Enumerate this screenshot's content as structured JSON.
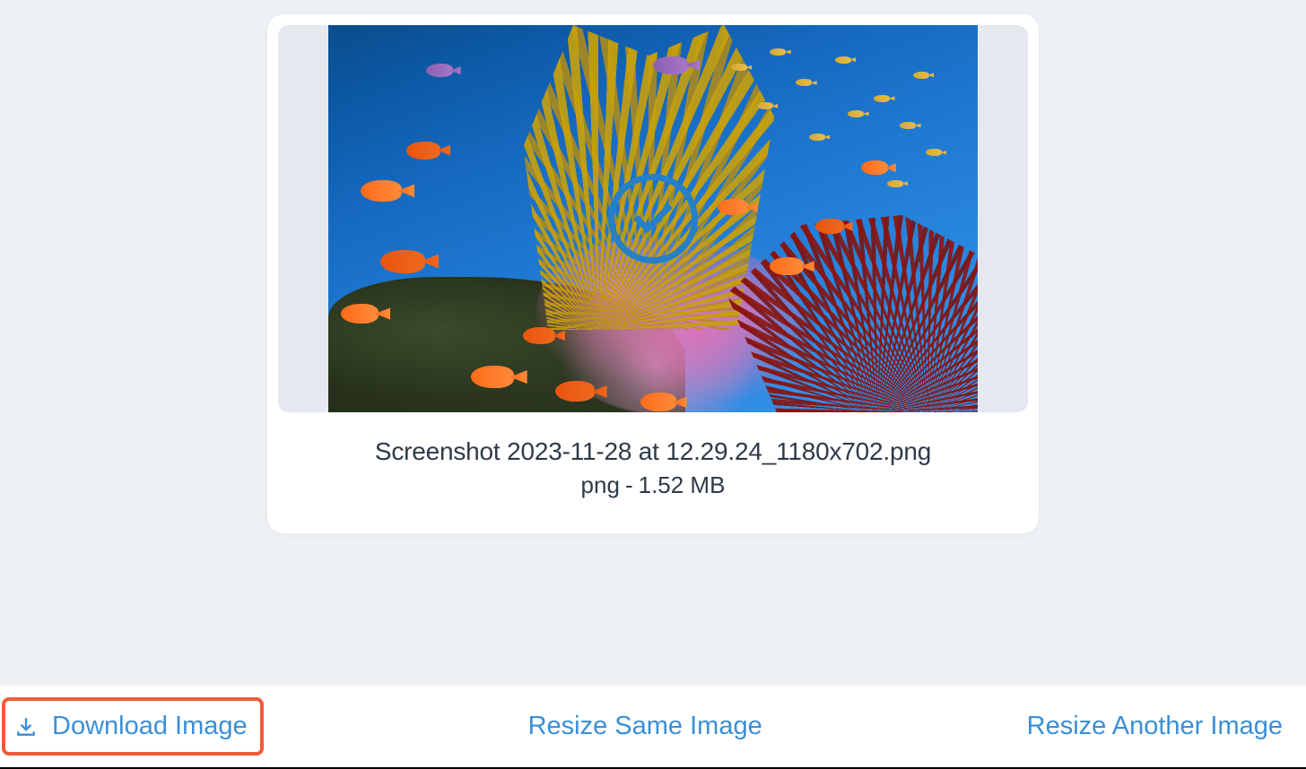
{
  "result": {
    "filename": "Screenshot 2023-11-28 at 12.29.24_1180x702.png",
    "format": "png",
    "size": "1.52 MB"
  },
  "actions": {
    "download": "Download Image",
    "resize_same": "Resize Same Image",
    "resize_another": "Resize Another Image"
  }
}
